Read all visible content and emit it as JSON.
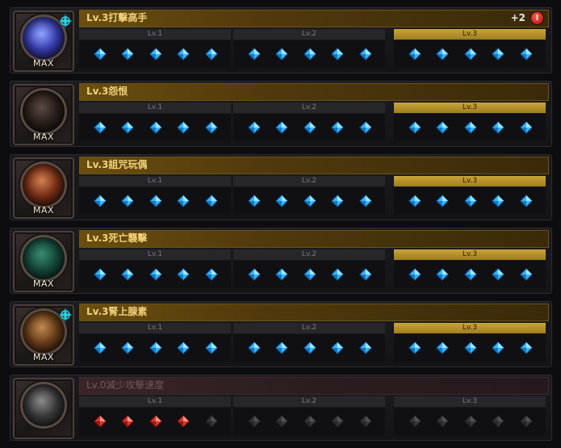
{
  "skills": [
    {
      "name": "Lv.3打擊高手",
      "max_label": "MAX",
      "plus": "+2",
      "alert": "!",
      "star": true,
      "active": true,
      "current_level": 3,
      "levels": [
        "Lv.1",
        "Lv.2",
        "Lv.3"
      ],
      "gems": [
        [
          "blue",
          "blue",
          "blue",
          "blue",
          "blue"
        ],
        [
          "blue",
          "blue",
          "blue",
          "blue",
          "blue"
        ],
        [
          "blue",
          "blue",
          "blue",
          "blue",
          "blue"
        ]
      ],
      "orb_colors": [
        "#8fa4ff",
        "#3a3fb0",
        "#0b0b2a"
      ],
      "icon": "lightning-orb-icon"
    },
    {
      "name": "Lv.3怨恨",
      "max_label": "MAX",
      "star": false,
      "active": true,
      "current_level": 3,
      "levels": [
        "Lv.1",
        "Lv.2",
        "Lv.3"
      ],
      "gems": [
        [
          "blue",
          "blue",
          "blue",
          "blue",
          "blue"
        ],
        [
          "blue",
          "blue",
          "blue",
          "blue",
          "blue"
        ],
        [
          "blue",
          "blue",
          "blue",
          "blue",
          "blue"
        ]
      ],
      "orb_colors": [
        "#5a4a44",
        "#2a201c",
        "#0a0808"
      ],
      "icon": "hooded-figure-icon"
    },
    {
      "name": "Lv.3詛咒玩偶",
      "max_label": "MAX",
      "star": false,
      "active": true,
      "current_level": 3,
      "levels": [
        "Lv.1",
        "Lv.2",
        "Lv.3"
      ],
      "gems": [
        [
          "blue",
          "blue",
          "blue",
          "blue",
          "blue"
        ],
        [
          "blue",
          "blue",
          "blue",
          "blue",
          "blue"
        ],
        [
          "blue",
          "blue",
          "blue",
          "blue",
          "blue"
        ]
      ],
      "orb_colors": [
        "#d08050",
        "#7a3018",
        "#1a0a06"
      ],
      "icon": "voodoo-doll-icon"
    },
    {
      "name": "Lv.3死亡襲擊",
      "max_label": "MAX",
      "star": false,
      "active": true,
      "current_level": 3,
      "levels": [
        "Lv.1",
        "Lv.2",
        "Lv.3"
      ],
      "gems": [
        [
          "blue",
          "blue",
          "blue",
          "blue",
          "blue"
        ],
        [
          "blue",
          "blue",
          "blue",
          "blue",
          "blue"
        ],
        [
          "blue",
          "blue",
          "blue",
          "blue",
          "blue"
        ]
      ],
      "orb_colors": [
        "#3a8a70",
        "#164a3c",
        "#061612"
      ],
      "icon": "death-strike-icon"
    },
    {
      "name": "Lv.3腎上腺素",
      "max_label": "MAX",
      "star": true,
      "active": true,
      "current_level": 3,
      "levels": [
        "Lv.1",
        "Lv.2",
        "Lv.3"
      ],
      "gems": [
        [
          "blue",
          "blue",
          "blue",
          "blue",
          "blue"
        ],
        [
          "blue",
          "blue",
          "blue",
          "blue",
          "blue"
        ],
        [
          "blue",
          "blue",
          "blue",
          "blue",
          "blue"
        ]
      ],
      "orb_colors": [
        "#c08a50",
        "#6a3e1a",
        "#160c06"
      ],
      "icon": "adrenaline-icon"
    },
    {
      "name": "Lv.0減少攻擊速度",
      "max_label": "",
      "star": false,
      "active": false,
      "current_level": 0,
      "levels": [
        "Lv.1",
        "Lv.2",
        "Lv.3"
      ],
      "gems": [
        [
          "red",
          "red",
          "red",
          "red",
          "gray"
        ],
        [
          "gray",
          "gray",
          "gray",
          "gray",
          "gray"
        ],
        [
          "gray",
          "gray",
          "gray",
          "gray",
          "gray"
        ]
      ],
      "orb_colors": [
        "#8a8a8a",
        "#3a3a3a",
        "#101010"
      ],
      "icon": "reduce-attack-speed-icon"
    }
  ],
  "gem_colors": {
    "blue": [
      "#bff3ff",
      "#37b8ff",
      "#0b5fa8"
    ],
    "red": [
      "#ffb0a0",
      "#e0352a",
      "#7a0d0a"
    ],
    "gray": [
      "#5a5a5e",
      "#38383c",
      "#202023"
    ]
  },
  "star_color": "#2fd0e0"
}
